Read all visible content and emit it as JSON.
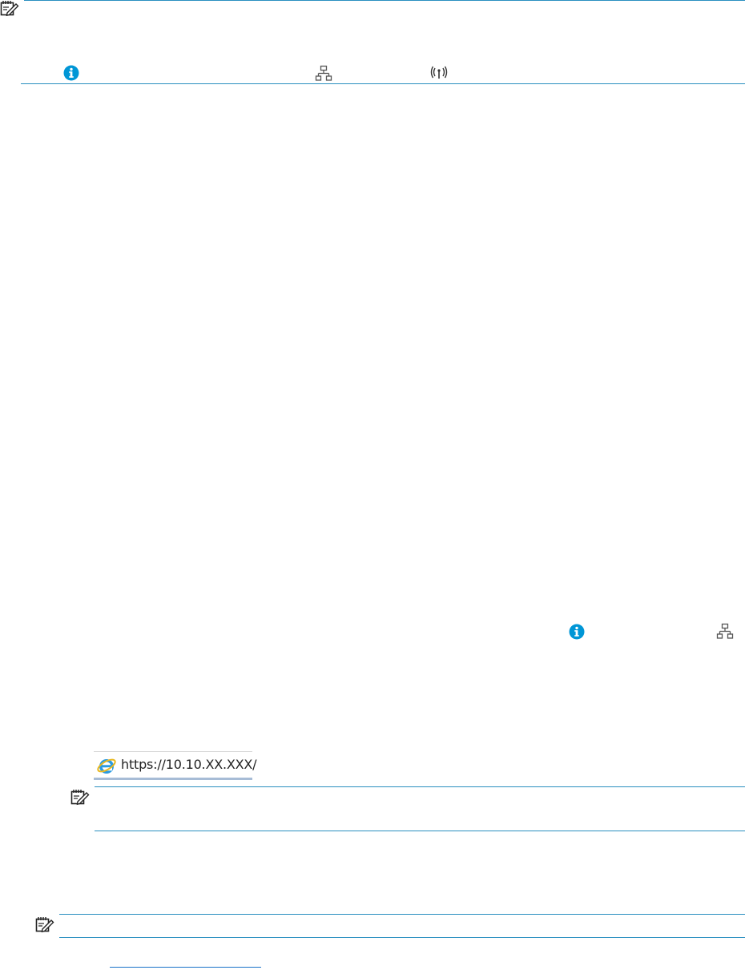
{
  "address_bar": {
    "url": "https://10.10.XX.XXX/"
  },
  "colors": {
    "rule": "#2a8fc0",
    "info_icon": "#0096d6",
    "icon_gray": "#555555",
    "link": "#1a73c8"
  },
  "icons": {
    "note": "note-icon",
    "information": "information-icon",
    "ethernet": "ethernet-network-icon",
    "wireless": "wireless-icon",
    "browser": "internet-explorer-icon"
  }
}
